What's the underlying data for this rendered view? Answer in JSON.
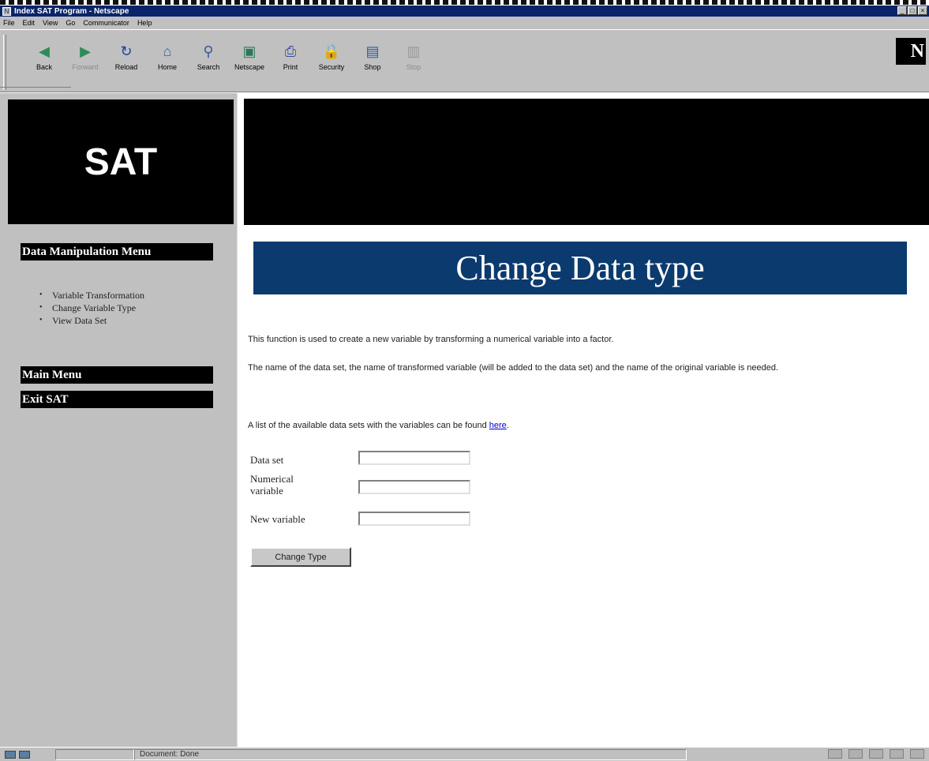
{
  "window": {
    "title": "Index SAT Program - Netscape",
    "controls": [
      "_",
      "□",
      "×"
    ]
  },
  "menubar": [
    "File",
    "Edit",
    "View",
    "Go",
    "Communicator",
    "Help"
  ],
  "toolbar": {
    "buttons": [
      {
        "label": "Back",
        "icon": "back-arrow-icon",
        "glyph": "◀",
        "color": "#2e8b57",
        "enabled": true
      },
      {
        "label": "Forward",
        "icon": "forward-arrow-icon",
        "glyph": "▶",
        "color": "#2e8b57",
        "enabled": false
      },
      {
        "label": "Reload",
        "icon": "reload-icon",
        "glyph": "↻",
        "color": "#1a3fa0",
        "enabled": true
      },
      {
        "label": "Home",
        "icon": "home-icon",
        "glyph": "⌂",
        "color": "#2a6a9a",
        "enabled": true
      },
      {
        "label": "Search",
        "icon": "search-icon",
        "glyph": "⚲",
        "color": "#3a5a9a",
        "enabled": true
      },
      {
        "label": "Netscape",
        "icon": "netscape-icon",
        "glyph": "▣",
        "color": "#2a7a5a",
        "enabled": true
      },
      {
        "label": "Print",
        "icon": "print-icon",
        "glyph": "⎙",
        "color": "#3a4a9a",
        "enabled": true
      },
      {
        "label": "Security",
        "icon": "security-icon",
        "glyph": "🔒",
        "color": "#9a3a2a",
        "enabled": true
      },
      {
        "label": "Shop",
        "icon": "shop-icon",
        "glyph": "▤",
        "color": "#2a5aaa",
        "enabled": true
      },
      {
        "label": "Stop",
        "icon": "stop-icon",
        "glyph": "▥",
        "color": "#9a9a9a",
        "enabled": false
      }
    ],
    "brand": "N"
  },
  "sidebar": {
    "logo": "SAT",
    "section_title": "Data Manipulation Menu",
    "items": [
      "Variable Transformation",
      "Change Variable Type",
      "View Data Set"
    ],
    "main_menu": "Main Menu",
    "exit": "Exit SAT"
  },
  "main": {
    "heading": "Change Data type",
    "para1": "This function is used to create a new variable by transforming a numerical variable into a factor.",
    "para2": "The name of the data set, the name of transformed variable (will be added to the data set) and the name of the original variable is needed.",
    "para3_prefix": "A list of the available data sets with the variables can be found ",
    "para3_link": "here",
    "para3_suffix": ".",
    "form": {
      "data_set_label": "Data set",
      "numerical_label_line1": "Numerical",
      "numerical_label_line2": "variable",
      "new_variable_label": "New variable",
      "data_set_value": "",
      "numerical_value": "",
      "new_variable_value": "",
      "submit_label": "Change Type"
    }
  },
  "statusbar": {
    "text": "Document: Done"
  }
}
